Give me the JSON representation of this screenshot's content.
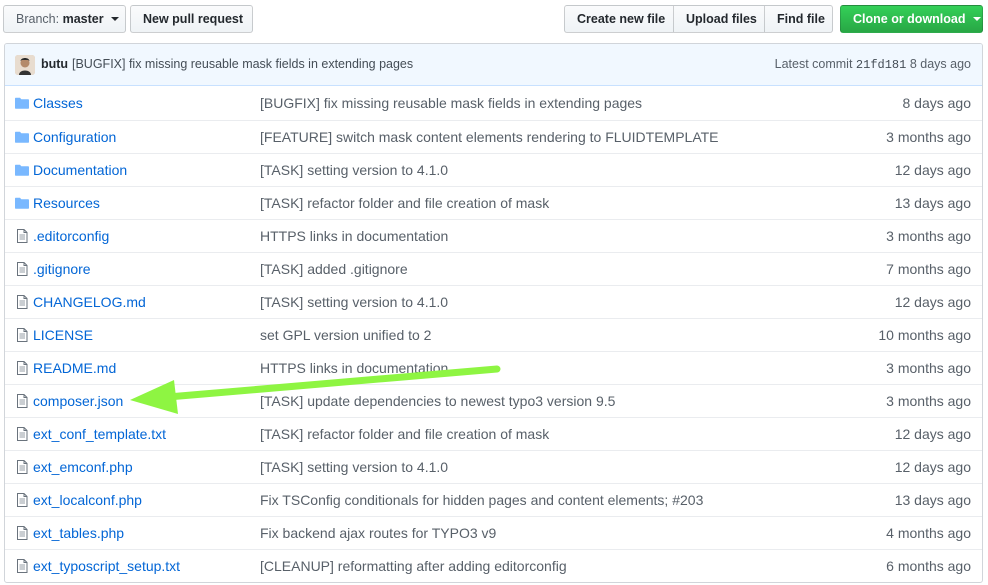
{
  "toolbar": {
    "branch_prefix": "Branch:",
    "branch_name": "master",
    "new_pull_request": "New pull request",
    "create_new_file": "Create new file",
    "upload_files": "Upload files",
    "find_file": "Find file",
    "clone_or_download": "Clone or download"
  },
  "commit": {
    "author": "butu",
    "message": "[BUGFIX] fix missing reusable mask fields in extending pages",
    "latest_label": "Latest commit",
    "sha": "21fd181",
    "age": "8 days ago"
  },
  "files": [
    {
      "type": "folder",
      "name": "Classes",
      "message": "[BUGFIX] fix missing reusable mask fields in extending pages",
      "age": "8 days ago"
    },
    {
      "type": "folder",
      "name": "Configuration",
      "message": "[FEATURE] switch mask content elements rendering to FLUIDTEMPLATE",
      "age": "3 months ago"
    },
    {
      "type": "folder",
      "name": "Documentation",
      "message": "[TASK] setting version to 4.1.0",
      "age": "12 days ago"
    },
    {
      "type": "folder",
      "name": "Resources",
      "message": "[TASK] refactor folder and file creation of mask",
      "age": "13 days ago"
    },
    {
      "type": "file",
      "name": ".editorconfig",
      "message": "HTTPS links in documentation",
      "age": "3 months ago"
    },
    {
      "type": "file",
      "name": ".gitignore",
      "message": "[TASK] added .gitignore",
      "age": "7 months ago"
    },
    {
      "type": "file",
      "name": "CHANGELOG.md",
      "message": "[TASK] setting version to 4.1.0",
      "age": "12 days ago"
    },
    {
      "type": "file",
      "name": "LICENSE",
      "message": "set GPL version unified to 2",
      "age": "10 months ago"
    },
    {
      "type": "file",
      "name": "README.md",
      "message": "HTTPS links in documentation",
      "age": "3 months ago"
    },
    {
      "type": "file",
      "name": "composer.json",
      "message": "[TASK] update dependencies to newest typo3 version 9.5",
      "age": "3 months ago"
    },
    {
      "type": "file",
      "name": "ext_conf_template.txt",
      "message": "[TASK] refactor folder and file creation of mask",
      "age": "12 days ago"
    },
    {
      "type": "file",
      "name": "ext_emconf.php",
      "message": "[TASK] setting version to 4.1.0",
      "age": "12 days ago"
    },
    {
      "type": "file",
      "name": "ext_localconf.php",
      "message": "Fix TSConfig conditionals for hidden pages and content elements; #203",
      "age": "13 days ago"
    },
    {
      "type": "file",
      "name": "ext_tables.php",
      "message": "Fix backend ajax routes for TYPO3 v9",
      "age": "4 months ago"
    },
    {
      "type": "file",
      "name": "ext_typoscript_setup.txt",
      "message": "[CLEANUP] reformatting after adding editorconfig",
      "age": "6 months ago"
    }
  ],
  "colors": {
    "link": "#0366d6",
    "muted": "#586069",
    "clone_green": "#28a745",
    "commit_bar": "#f1f8ff",
    "annotation_arrow": "#8ef542"
  },
  "icons": {
    "folder": "folder-icon",
    "file": "file-icon"
  }
}
